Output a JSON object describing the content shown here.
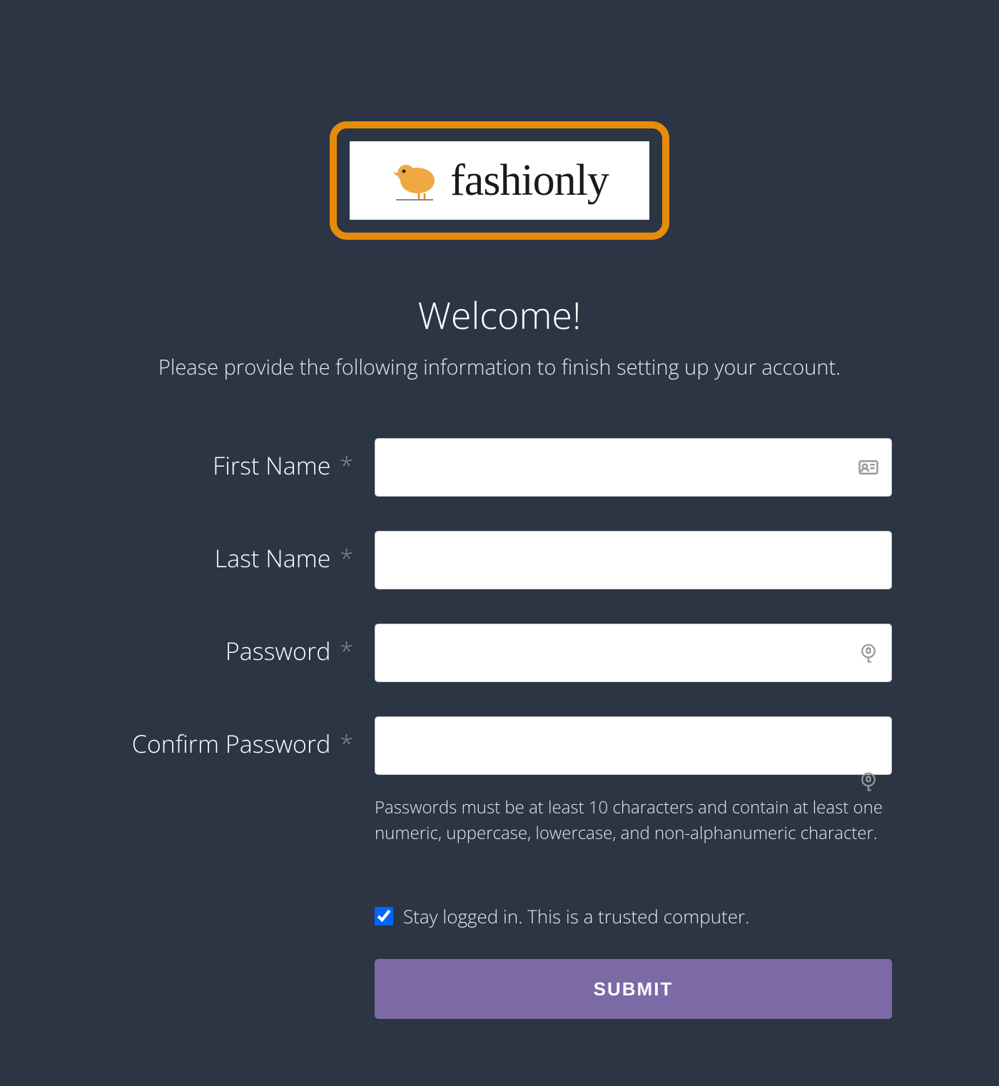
{
  "logo": {
    "text": "fashionly"
  },
  "welcome": {
    "title": "Welcome!",
    "subtitle": "Please provide the following information to finish setting up your account."
  },
  "form": {
    "first_name": {
      "label": "First Name",
      "value": ""
    },
    "last_name": {
      "label": "Last Name",
      "value": ""
    },
    "password": {
      "label": "Password",
      "value": ""
    },
    "confirm_password": {
      "label": "Confirm Password",
      "value": "",
      "help": "Passwords must be at least 10 characters and contain at least one numeric, uppercase, lowercase, and non-alphanumeric character."
    },
    "stay_logged_in": {
      "label": "Stay logged in. This is a trusted computer.",
      "checked": true
    },
    "submit_label": "SUBMIT"
  }
}
